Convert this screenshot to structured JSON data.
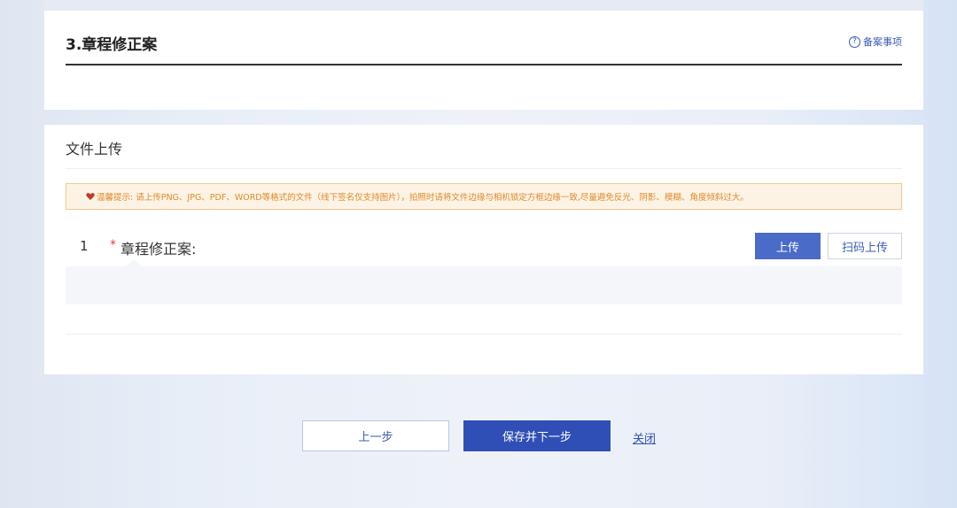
{
  "section": {
    "title": "3.章程修正案",
    "help_link": "备案事项",
    "help_icon": "question-circle-icon"
  },
  "upload": {
    "title": "文件上传",
    "tip": {
      "icon": "heart-icon",
      "text": "温馨提示: 请上传PNG、JPG、PDF、WORD等格式的文件（线下签名仅支持图片），拍照时请将文件边缘与相机锁定方框边缘一致,尽量避免反光、阴影、模糊、角度倾斜过大。",
      "color": "#e08a2a",
      "background": "#fdf3e5"
    },
    "items": [
      {
        "index": "1",
        "required_mark": "*",
        "label": "章程修正案:",
        "upload_button": "上传",
        "scan_button": "扫码上传"
      }
    ]
  },
  "footer": {
    "prev_button": "上一步",
    "next_button": "保存并下一步",
    "close_link": "关闭"
  },
  "colors": {
    "primary": "#2f4fb6",
    "upload_button": "#4a6cc8",
    "required": "#e0453a"
  }
}
